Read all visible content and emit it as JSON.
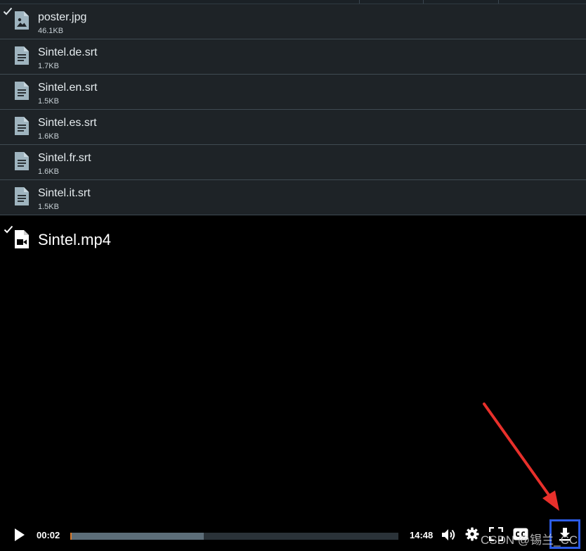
{
  "files": [
    {
      "name": "poster.jpg",
      "size": "46.1KB",
      "type": "image",
      "checked": true
    },
    {
      "name": "Sintel.de.srt",
      "size": "1.7KB",
      "type": "text",
      "checked": false
    },
    {
      "name": "Sintel.en.srt",
      "size": "1.5KB",
      "type": "text",
      "checked": false
    },
    {
      "name": "Sintel.es.srt",
      "size": "1.6KB",
      "type": "text",
      "checked": false
    },
    {
      "name": "Sintel.fr.srt",
      "size": "1.6KB",
      "type": "text",
      "checked": false
    },
    {
      "name": "Sintel.it.srt",
      "size": "1.5KB",
      "type": "text",
      "checked": false
    }
  ],
  "video": {
    "title": "Sintel.mp4",
    "checked": true,
    "current_time": "00:02",
    "duration": "14:48",
    "played_fraction": 0.002,
    "buffered_fraction": 0.406
  },
  "watermark": "CSDN @锡兰_CC",
  "colors": {
    "row_bg": "#1e2327",
    "row_border": "#3f4a52",
    "icon": "#9fb4bf",
    "highlight_box": "#2c5ce6",
    "annotation_arrow": "#e8302b"
  }
}
